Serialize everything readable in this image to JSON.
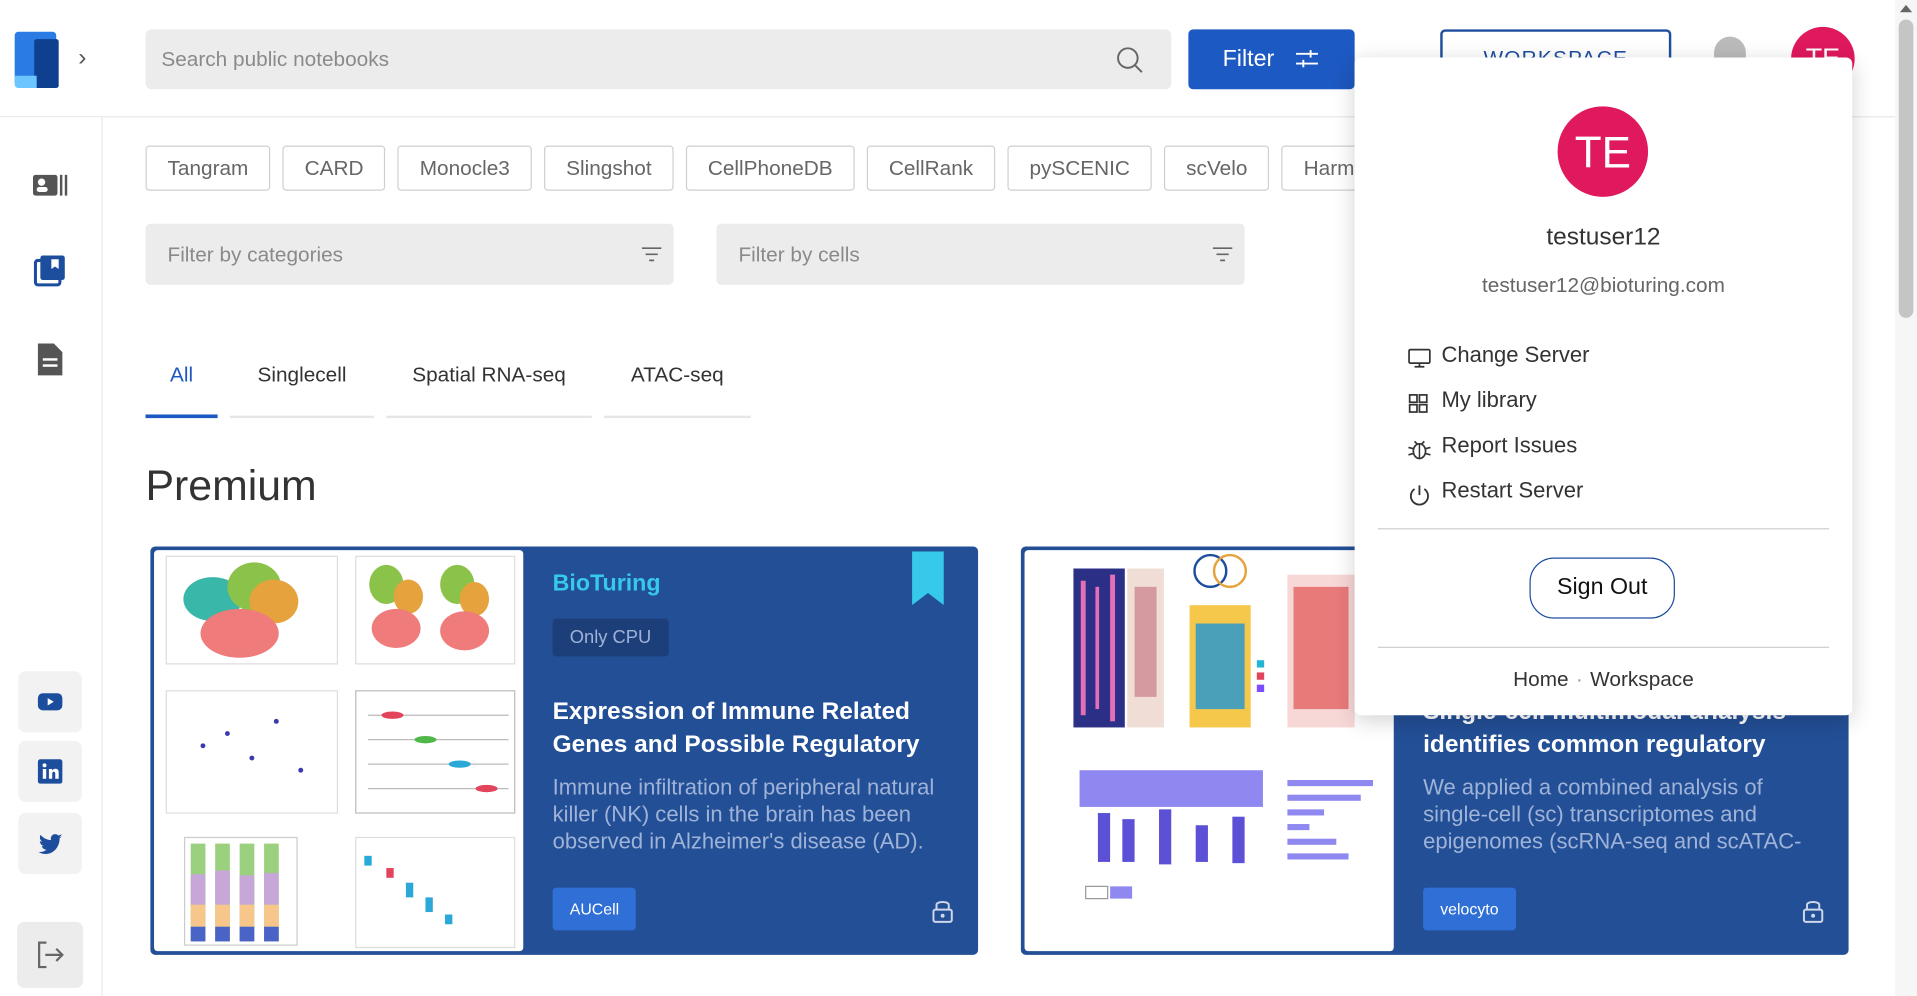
{
  "search": {
    "placeholder": "Search public notebooks"
  },
  "header": {
    "filter_label": "Filter",
    "workspace_label": "WORKSPACE",
    "avatar_initials": "TE"
  },
  "chips": [
    "Tangram",
    "CARD",
    "Monocle3",
    "Slingshot",
    "CellPhoneDB",
    "CellRank",
    "pySCENIC",
    "scVelo",
    "Harmony"
  ],
  "filters": {
    "categories_placeholder": "Filter by categories",
    "cells_placeholder": "Filter by cells"
  },
  "tabs": [
    "All",
    "Singlecell",
    "Spatial RNA-seq",
    "ATAC-seq"
  ],
  "section_title": "Premium",
  "cards": [
    {
      "brand": "BioTuring",
      "badge": "Only CPU",
      "title": "Expression of Immune Related Genes and Possible Regulatory",
      "description": "Immune infiltration of peripheral natural killer (NK) cells in the brain has been observed in Alzheimer's disease (AD).",
      "tag": "AUCell"
    },
    {
      "title": "Single-cell multimodal analysis identifies common regulatory",
      "description": "We applied a combined analysis of single-cell (sc) transcriptomes and epigenomes (scRNA-seq and scATAC-",
      "tag": "velocyto"
    }
  ],
  "user_menu": {
    "initials": "TE",
    "username": "testuser12",
    "email": "testuser12@bioturing.com",
    "items": [
      "Change Server",
      "My library",
      "Report Issues",
      "Restart Server"
    ],
    "sign_out": "Sign Out",
    "footer_links": [
      "Home",
      "Workspace"
    ],
    "footer_separator": "·"
  },
  "colors": {
    "primary": "#1d59c2",
    "card_bg": "#234f96",
    "avatar": "#e0185d",
    "brand_accent": "#37c9ea"
  }
}
